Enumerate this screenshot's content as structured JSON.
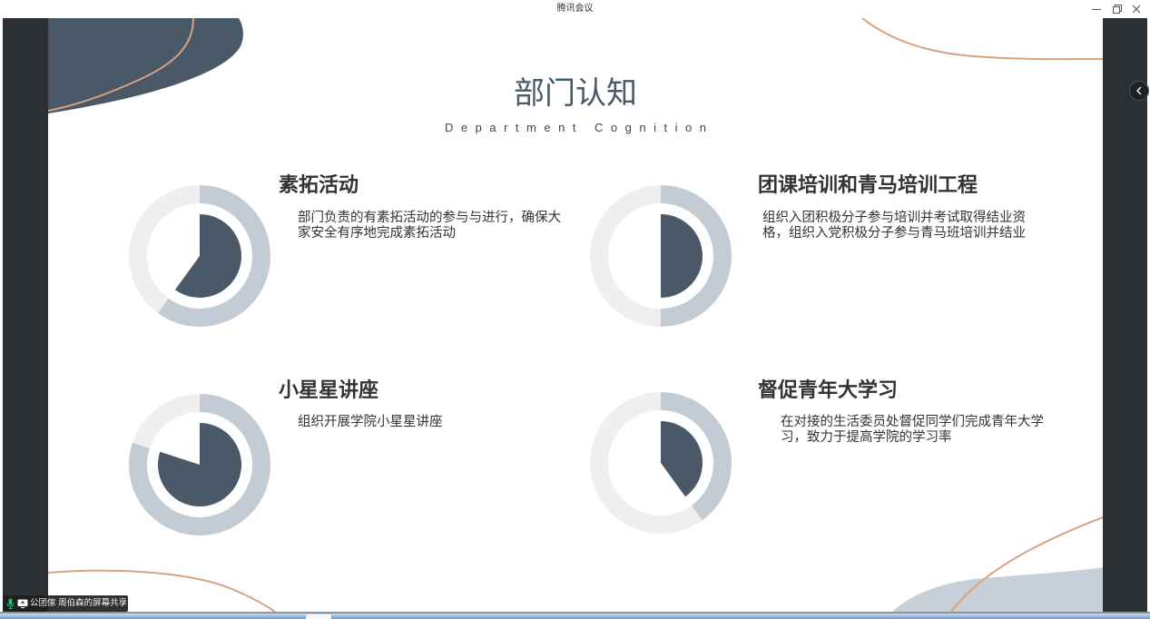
{
  "window": {
    "title": "腾讯会议",
    "control_icons": [
      "minimize-icon",
      "restore-icon",
      "close-icon"
    ]
  },
  "share": {
    "status_text": "公团傢 周伯森的屏幕共享",
    "status_icons": [
      "microphone-icon",
      "screen-share-icon"
    ],
    "collapse_icon": "chevron-left-icon"
  },
  "slide": {
    "title": "部门认知",
    "subtitle": "Department Cognition",
    "sections": [
      {
        "heading": "素拓活动",
        "description": "部门负责的有素拓活动的参与与进行，确保大家安全有序地完成素拓活动",
        "ring_fraction": 0.6,
        "pie_fraction": 0.6
      },
      {
        "heading": "团课培训和青马培训工程",
        "description": "组织入团积极分子参与培训并考试取得结业资格，组织入党积极分子参与青马班培训并结业",
        "ring_fraction": 0.5,
        "pie_fraction": 0.5
      },
      {
        "heading": "小星星讲座",
        "description": "组织开展学院小星星讲座",
        "ring_fraction": 0.8,
        "pie_fraction": 0.8
      },
      {
        "heading": "督促青年大学习",
        "description": "在对接的生活委员处督促同学们完成青年大学习，致力于提高学院的学习率",
        "ring_fraction": 0.4,
        "pie_fraction": 0.4
      }
    ]
  },
  "colors": {
    "accent": "#4a5968",
    "ring_fill": "#c3ccd5",
    "ring_track": "#efefef",
    "pie_fill": "#4a5968",
    "curve_line": "#d8a27f",
    "light_shape": "#c7d0d9",
    "frame": "#2c3034",
    "mic_active": "#22c06a"
  }
}
